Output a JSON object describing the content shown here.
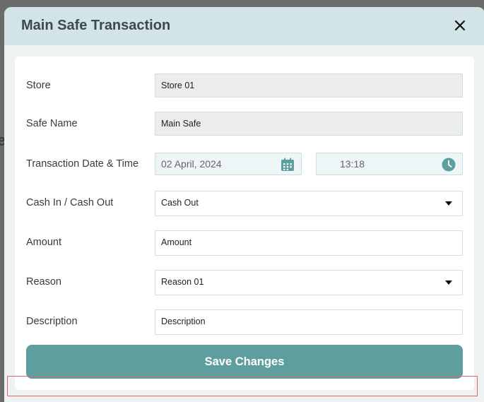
{
  "modal": {
    "title": "Main Safe Transaction"
  },
  "form": {
    "store": {
      "label": "Store",
      "value": "Store 01"
    },
    "safe_name": {
      "label": "Safe Name",
      "value": "Main Safe"
    },
    "transaction_datetime": {
      "label": "Transaction Date & Time",
      "date": "02 April, 2024",
      "time": "13:18"
    },
    "cash_in_out": {
      "label": "Cash In / Cash Out",
      "value": "Cash Out"
    },
    "amount": {
      "label": "Amount",
      "placeholder": "Amount"
    },
    "reason": {
      "label": "Reason",
      "value": "Reason 01"
    },
    "description": {
      "label": "Description",
      "placeholder": "Description"
    }
  },
  "actions": {
    "save_label": "Save Changes"
  },
  "icons": {
    "close": "close-icon",
    "calendar": "calendar-icon",
    "clock": "clock-icon",
    "dropdown": "chevron-down-icon"
  },
  "colors": {
    "header_bg": "#d3e4e6",
    "accent": "#5f9e9f",
    "field_border": "#c8dfe1",
    "readonly_bg": "#ececec",
    "highlight": "#e06666"
  }
}
